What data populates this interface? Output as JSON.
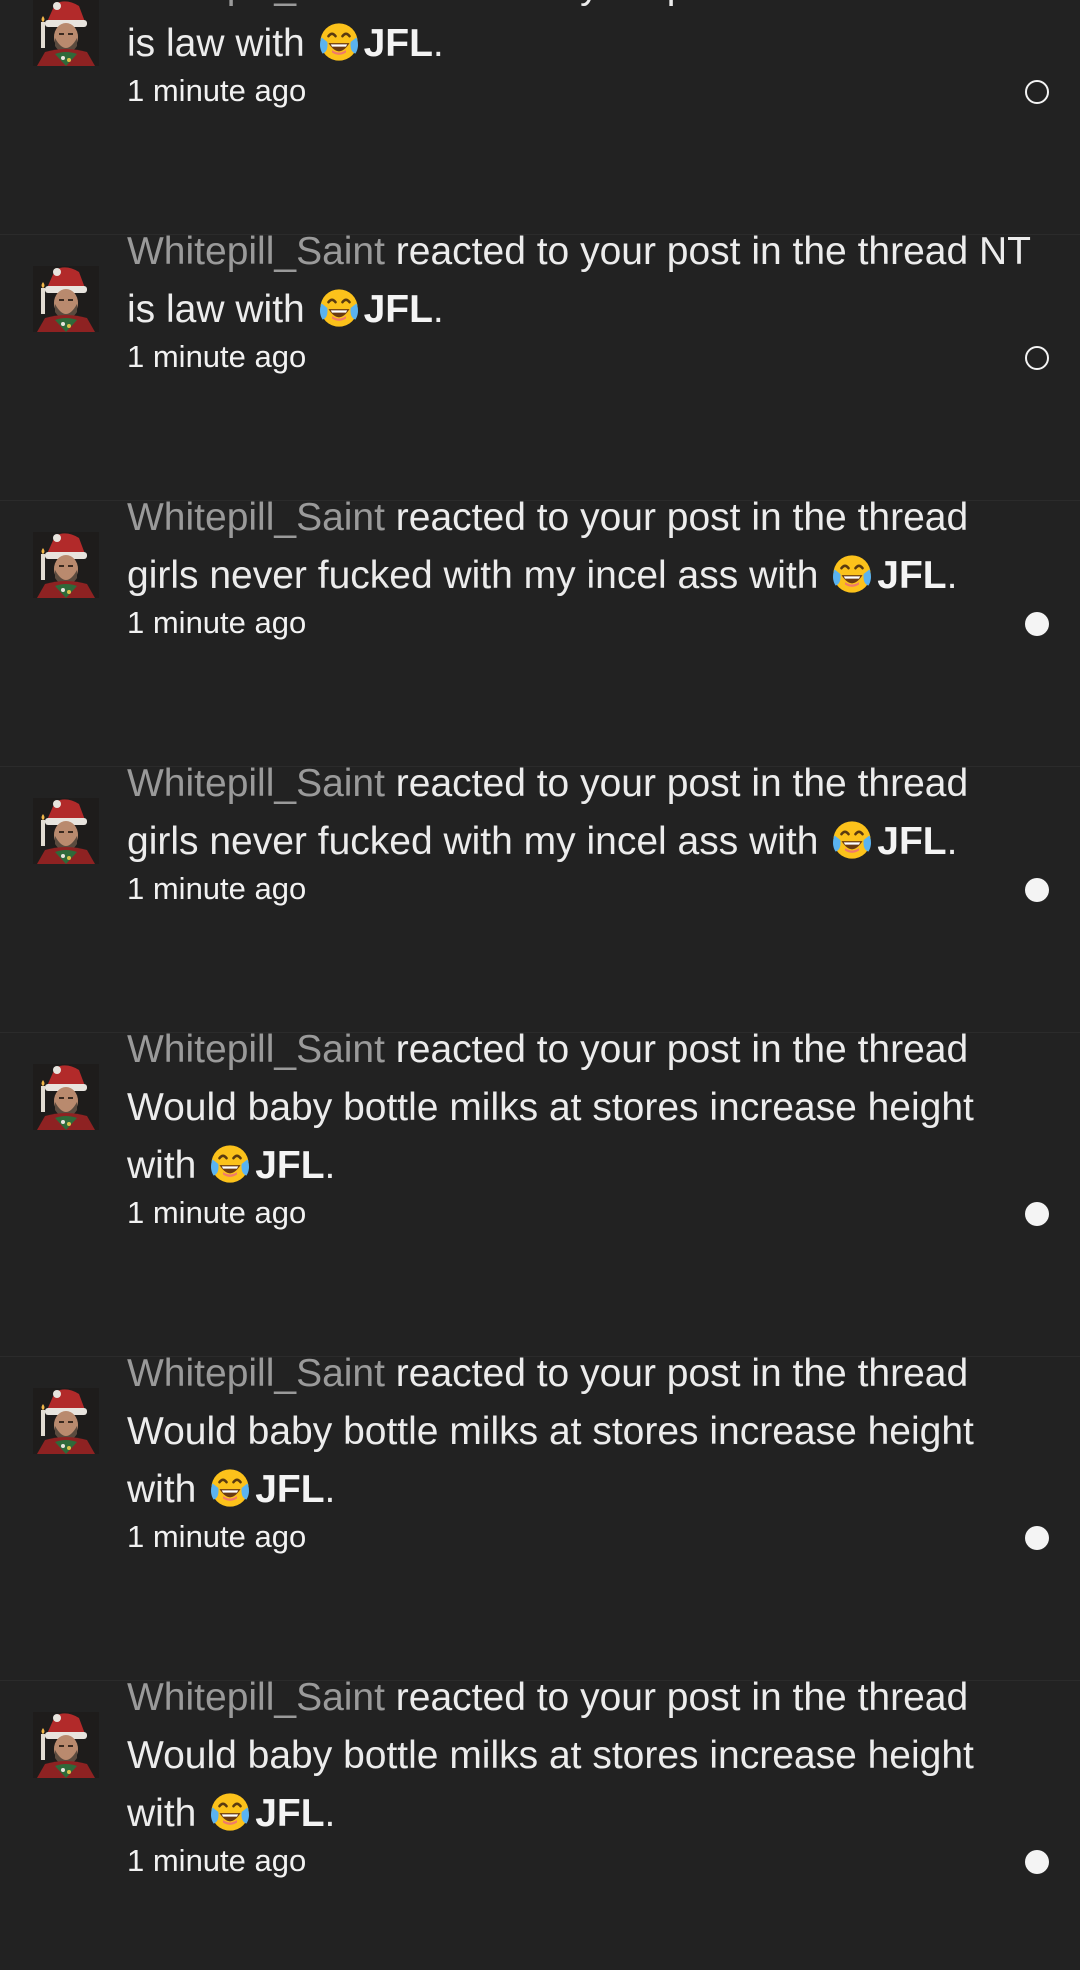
{
  "notifications": [
    {
      "username": "Whitepill_Saint",
      "action": " reacted to your post in the thread ",
      "thread": "NT is law",
      "with_word": " with ",
      "reaction": "JFL",
      "period": ".",
      "time": "1 minute ago",
      "read": true
    },
    {
      "username": "Whitepill_Saint",
      "action": " reacted to your post in the thread ",
      "thread": "NT is law",
      "with_word": " with ",
      "reaction": "JFL",
      "period": ".",
      "time": "1 minute ago",
      "read": true
    },
    {
      "username": "Whitepill_Saint",
      "action": " reacted to your post in the thread ",
      "thread": "girls never fucked with my incel ass",
      "with_word": " with ",
      "reaction": "JFL",
      "period": ".",
      "time": "1 minute ago",
      "read": false
    },
    {
      "username": "Whitepill_Saint",
      "action": " reacted to your post in the thread ",
      "thread": "girls never fucked with my incel ass",
      "with_word": " with ",
      "reaction": "JFL",
      "period": ".",
      "time": "1 minute ago",
      "read": false
    },
    {
      "username": "Whitepill_Saint",
      "action": " reacted to your post in the thread ",
      "thread": "Would baby bottle milks at stores increase height",
      "with_word": " with ",
      "reaction": "JFL",
      "period": ".",
      "time": "1 minute ago",
      "read": false
    },
    {
      "username": "Whitepill_Saint",
      "action": " reacted to your post in the thread ",
      "thread": "Would baby bottle milks at stores increase height",
      "with_word": " with ",
      "reaction": "JFL",
      "period": ".",
      "time": "1 minute ago",
      "read": false
    },
    {
      "username": "Whitepill_Saint",
      "action": " reacted to your post in the thread ",
      "thread": "Would baby bottle milks at stores increase height",
      "with_word": " with ",
      "reaction": "JFL",
      "period": ".",
      "time": "1 minute ago",
      "read": false
    }
  ],
  "icons": {
    "avatar": "santa-avatar-icon",
    "reaction": "crying-laughing-emoji-icon",
    "read_marker": "read-status-dot-icon"
  },
  "colors": {
    "background": "#222222",
    "username": "#9a9a9a",
    "text": "#ececec",
    "marker": "#f4f4f4"
  }
}
